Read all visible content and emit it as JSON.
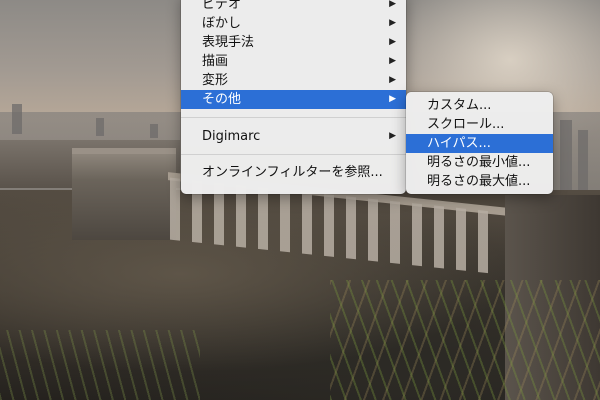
{
  "menu": {
    "items": [
      {
        "label": "ビデオ",
        "submenu": true
      },
      {
        "label": "ぼかし",
        "submenu": true
      },
      {
        "label": "表現手法",
        "submenu": true
      },
      {
        "label": "描画",
        "submenu": true
      },
      {
        "label": "変形",
        "submenu": true
      },
      {
        "label": "その他",
        "submenu": true,
        "active": true
      },
      {
        "label": "Digimarc",
        "submenu": true
      },
      {
        "label": "オンラインフィルターを参照...",
        "submenu": false
      }
    ],
    "arrow_glyph": "▶"
  },
  "submenu": {
    "items": [
      {
        "label": "カスタム..."
      },
      {
        "label": "スクロール..."
      },
      {
        "label": "ハイパス...",
        "active": true
      },
      {
        "label": "明るさの最小値..."
      },
      {
        "label": "明るさの最大値..."
      }
    ]
  },
  "colors": {
    "highlight": "#2c6fd6",
    "menu_bg": "#eeeeee"
  }
}
